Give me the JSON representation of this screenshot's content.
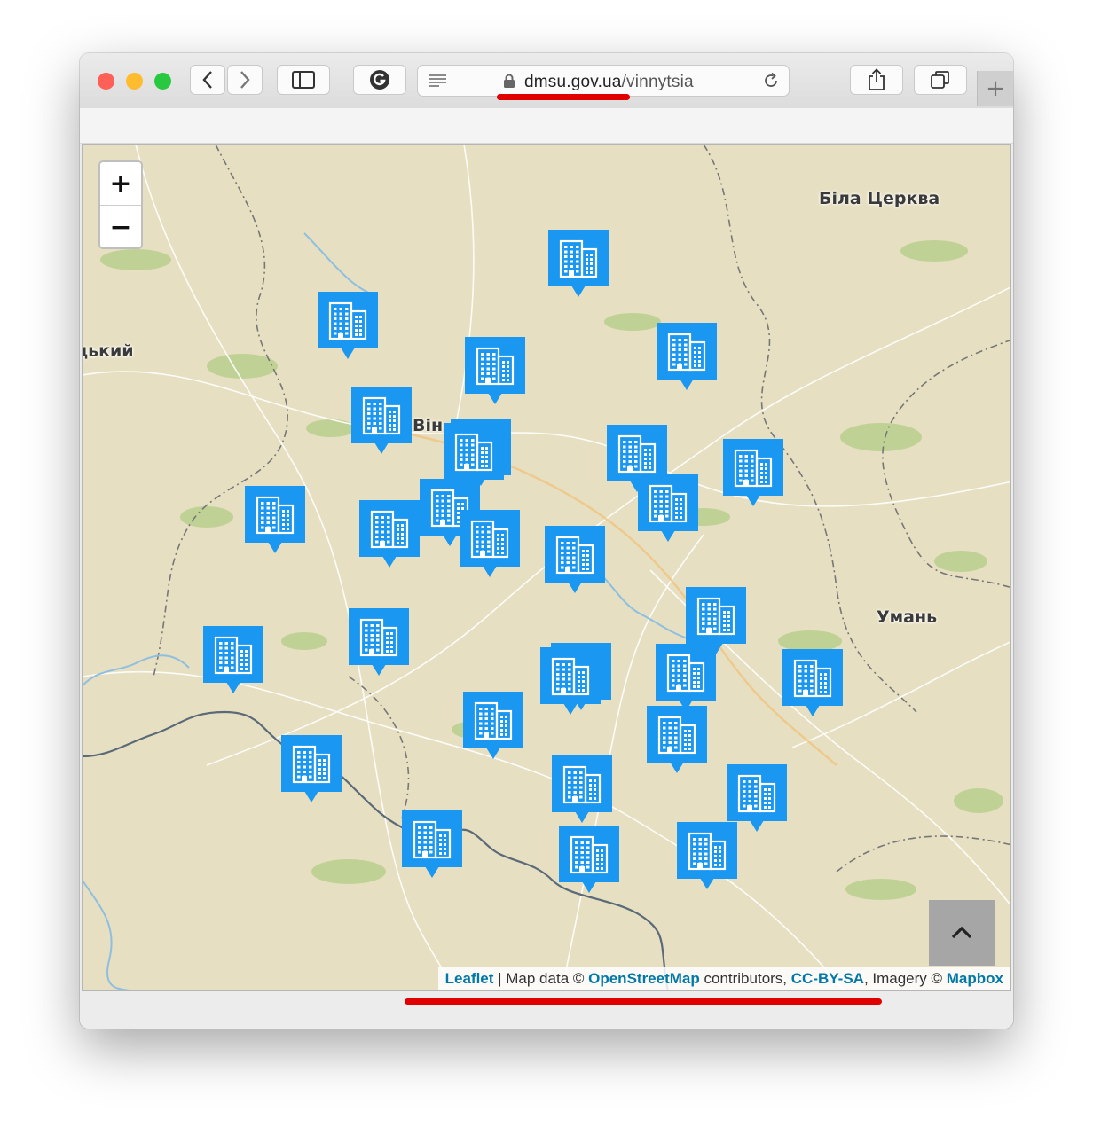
{
  "browser": {
    "url_host": "dmsu.gov.ua",
    "url_path": "/vinnytsia",
    "new_tab_label": "+",
    "traffic_lights": [
      "#fe5f57",
      "#febc2e",
      "#28c840"
    ]
  },
  "map": {
    "zoom_in_label": "+",
    "zoom_out_label": "−",
    "place_labels": [
      "Біла Церква",
      "цький",
      "Він",
      "Умань"
    ],
    "marker_icon": "office-building-icon",
    "marker_color": "#1a97f0",
    "scroll_top_icon": "chevron-up-icon",
    "attribution": {
      "leaflet": "Leaflet",
      "sep": " | Map data © ",
      "osm": "OpenStreetMap",
      "contributors": " contributors, ",
      "license": "CC-BY-SA",
      "imagery": ", Imagery © ",
      "mapbox": "Mapbox"
    }
  },
  "highlight_color": "#e00000"
}
